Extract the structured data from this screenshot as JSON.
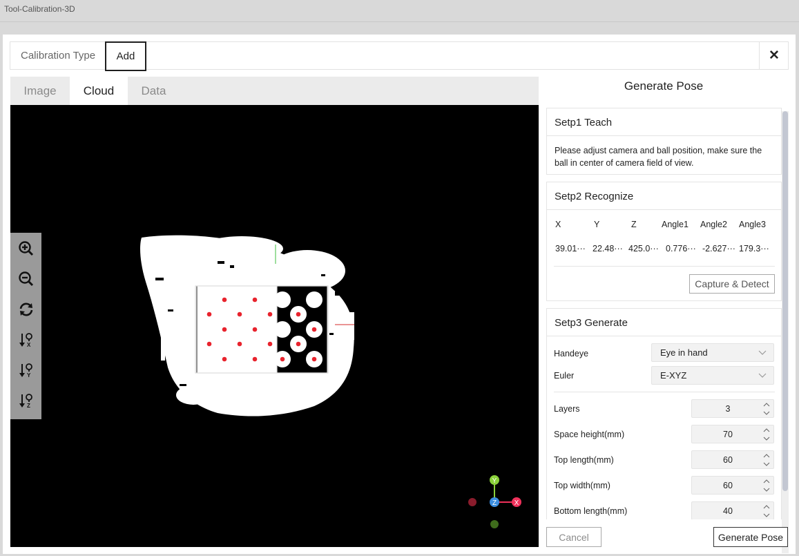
{
  "app": {
    "title": "Tool-Calibration-3D"
  },
  "header": {
    "calibration_type_label": "Calibration Type",
    "add_label": "Add",
    "close_glyph": "✕"
  },
  "tabs": [
    {
      "label": "Image",
      "active": false
    },
    {
      "label": "Cloud",
      "active": true
    },
    {
      "label": "Data",
      "active": false
    }
  ],
  "viewer": {
    "toolbar": [
      "zoom-in-icon",
      "zoom-out-icon",
      "rotate-reset-icon",
      "view-x-icon",
      "view-y-icon",
      "view-z-icon"
    ],
    "axes": {
      "x": "X",
      "y": "Y",
      "z": "Z"
    }
  },
  "panel": {
    "title": "Generate Pose",
    "step1": {
      "title": "Setp1 Teach",
      "description": "Please adjust camera and ball position, make sure the ball in center of camera field of view."
    },
    "step2": {
      "title": "Setp2 Recognize",
      "columns": [
        "X",
        "Y",
        "Z",
        "Angle1",
        "Angle2",
        "Angle3"
      ],
      "values": [
        "39.01···",
        "22.48···",
        "425.0···",
        "0.776···",
        "-2.627···",
        "179.3···"
      ],
      "capture_label": "Capture & Detect"
    },
    "step3": {
      "title": "Setp3 Generate",
      "handeye": {
        "label": "Handeye",
        "value": "Eye in hand"
      },
      "euler": {
        "label": "Euler",
        "value": "E-XYZ"
      },
      "params": [
        {
          "label": "Layers",
          "value": "3"
        },
        {
          "label": "Space height(mm)",
          "value": "70"
        },
        {
          "label": "Top length(mm)",
          "value": "60"
        },
        {
          "label": "Top width(mm)",
          "value": "60"
        },
        {
          "label": "Bottom length(mm)",
          "value": "40"
        }
      ]
    }
  },
  "footer": {
    "cancel_label": "Cancel",
    "generate_label": "Generate Pose"
  },
  "colors": {
    "point": "#e8232d",
    "axis_x": "#f0315b",
    "axis_y": "#8bd13a",
    "axis_z": "#3b8ee0"
  }
}
